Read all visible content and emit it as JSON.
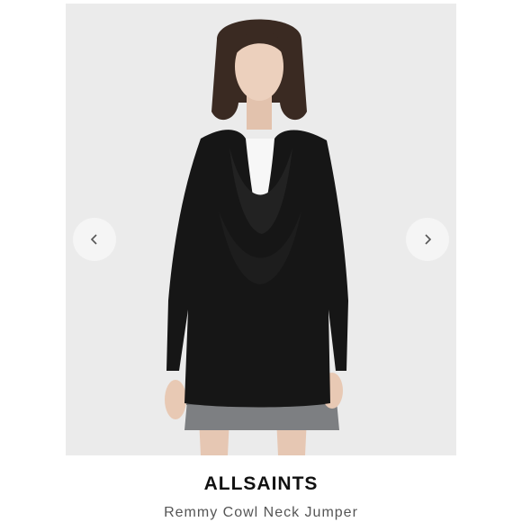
{
  "product": {
    "brand": "ALLSAINTS",
    "name": "Remmy Cowl Neck Jumper"
  },
  "carousel": {
    "prev_icon": "chevron-left-icon",
    "next_icon": "chevron-right-icon"
  },
  "colors": {
    "image_background": "#ebebeb",
    "garment": "#161616",
    "brand_text": "#111111",
    "name_text": "#555555"
  }
}
